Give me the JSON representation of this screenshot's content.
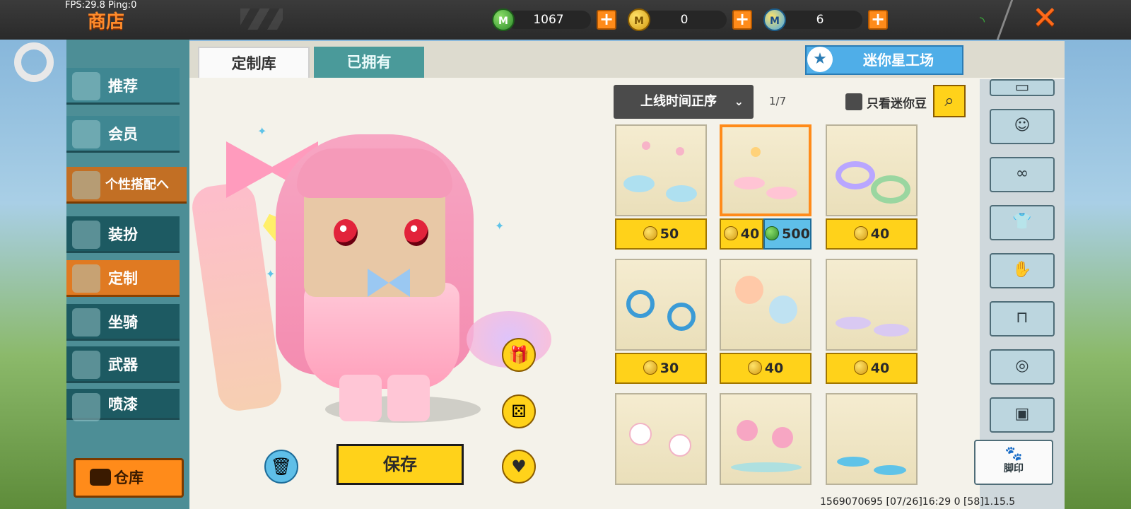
{
  "topbar": {
    "fps": "FPS:29.8 Ping:0",
    "title": "商店",
    "currencies": [
      {
        "icon": "mini-coin-green-icon",
        "value": "1067"
      },
      {
        "icon": "mini-coin-gold-icon",
        "value": "0"
      },
      {
        "icon": "mini-bean-blue-icon",
        "value": "6"
      }
    ],
    "close_icon": "close-x-icon",
    "signal_icon": "wifi-signal-icon"
  },
  "sidebar": {
    "items": [
      {
        "label": "推荐"
      },
      {
        "label": "会员"
      },
      {
        "label": "个性搭配へ"
      },
      {
        "label": "装扮"
      },
      {
        "label": "定制"
      },
      {
        "label": "坐骑"
      },
      {
        "label": "武器"
      },
      {
        "label": "喷漆"
      }
    ],
    "warehouse_label": "仓库"
  },
  "tabs": {
    "custom": "定制库",
    "owned": "已拥有"
  },
  "workshop_label": "迷你星工场",
  "sort": {
    "label": "上线时间正序",
    "page": "1/7",
    "filter_label": "只看迷你豆"
  },
  "items": [
    {
      "prices": [
        {
          "currency": "gold",
          "value": "50"
        }
      ]
    },
    {
      "prices": [
        {
          "currency": "gold",
          "value": "40"
        },
        {
          "currency": "gem",
          "value": "500"
        }
      ],
      "selected": true
    },
    {
      "prices": [
        {
          "currency": "gold",
          "value": "40"
        }
      ]
    },
    {
      "prices": [
        {
          "currency": "gold",
          "value": "30"
        }
      ]
    },
    {
      "prices": [
        {
          "currency": "gold",
          "value": "40"
        }
      ]
    },
    {
      "prices": [
        {
          "currency": "gold",
          "value": "40"
        }
      ]
    },
    {
      "prices": []
    },
    {
      "prices": []
    },
    {
      "prices": []
    }
  ],
  "save_label": "保存",
  "right_categories": {
    "active_label": "脚印",
    "icons": [
      "hat-icon",
      "face-icon",
      "mask-icon",
      "shirt-icon",
      "glove-icon",
      "pants-icon",
      "shoes-icon",
      "backpack-icon",
      "paw-icon"
    ]
  },
  "footer": "1569070695   [07/26]16:29 0   [58]1.15.5",
  "colors": {
    "accent_orange": "#ff8b1a",
    "price_yellow": "#ffd21a",
    "teal_sidebar": "#2f6f78"
  }
}
